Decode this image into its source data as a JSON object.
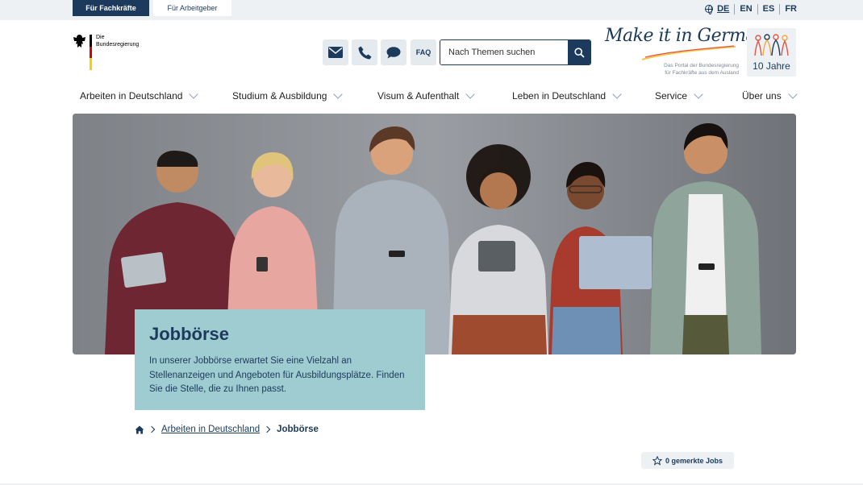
{
  "topbar": {
    "audience_tabs": [
      {
        "label": "Für Fachkräfte",
        "active": true
      },
      {
        "label": "Für Arbeitgeber",
        "active": false
      }
    ],
    "languages": [
      {
        "code": "DE",
        "current": true
      },
      {
        "code": "EN",
        "current": false
      },
      {
        "code": "ES",
        "current": false
      },
      {
        "code": "FR",
        "current": false
      }
    ]
  },
  "logo": {
    "line1": "Die",
    "line2": "Bundesregierung"
  },
  "utility": {
    "mail_icon": "envelope-icon",
    "phone_icon": "phone-icon",
    "chat_icon": "chat-icon",
    "faq_label": "FAQ"
  },
  "search": {
    "placeholder": "Nach Themen suchen",
    "icon": "search-icon"
  },
  "brand": {
    "script": "Make it in Germany",
    "sub_line1": "Das Portal der Bundesregierung",
    "sub_line2": "für Fachkräfte aus dem Ausland",
    "anniversary": "10 Jahre"
  },
  "nav": {
    "items": [
      {
        "label": "Arbeiten in Deutschland"
      },
      {
        "label": "Studium & Ausbildung"
      },
      {
        "label": "Visum & Aufenthalt"
      },
      {
        "label": "Leben in Deutschland"
      },
      {
        "label": "Service"
      },
      {
        "label": "Über uns"
      }
    ]
  },
  "hero": {
    "title": "Jobbörse",
    "text": "In unserer Jobbörse erwartet Sie eine Vielzahl an Stellenanzeigen und Angeboten für Ausbildungsplätze. Finden Sie die Stelle, die zu Ihnen passt."
  },
  "breadcrumb": {
    "home_icon": "home-icon",
    "items": [
      "Arbeiten in Deutschland"
    ],
    "current": "Jobbörse"
  },
  "saved_jobs": {
    "label": "0 gemerkte Jobs",
    "icon": "star-icon"
  },
  "colors": {
    "primary": "#1b3a5c",
    "teaser": "#9fccd0",
    "light": "#eef1f4"
  }
}
